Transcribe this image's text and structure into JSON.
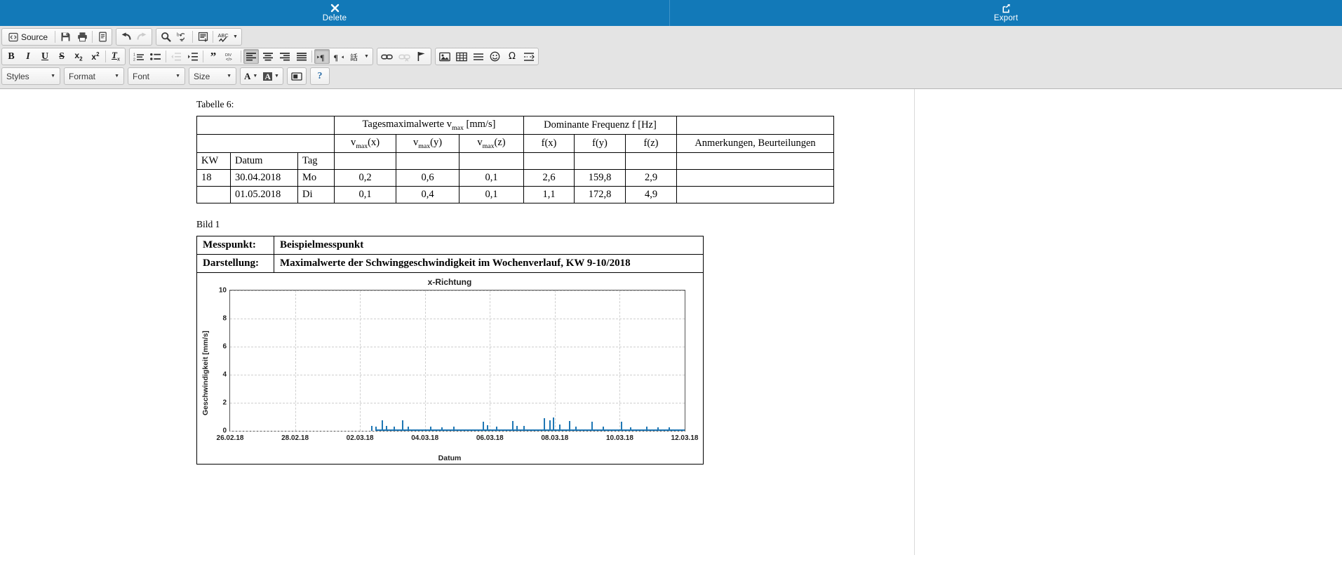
{
  "action_bar": {
    "background": "#1279b8",
    "buttons": [
      {
        "id": "delete",
        "label": "Delete",
        "icon": "close-x-icon"
      },
      {
        "id": "export",
        "label": "Export",
        "icon": "export-share-icon"
      }
    ]
  },
  "toolbar": {
    "source_label": "Source",
    "row1": [
      {
        "name": "source-button",
        "label": "Source",
        "icon": "source-code-icon"
      },
      {
        "name": "save-button",
        "icon": "floppy-save-icon"
      },
      {
        "name": "print-button",
        "icon": "printer-icon"
      },
      {
        "name": "new-page-button",
        "icon": "document-icon"
      },
      {
        "name": "undo-button",
        "icon": "undo-arrow-icon"
      },
      {
        "name": "redo-button",
        "icon": "redo-arrow-icon"
      },
      {
        "name": "find-button",
        "icon": "magnifier-icon"
      },
      {
        "name": "replace-button",
        "icon": "replace-ba-icon"
      },
      {
        "name": "select-all-button",
        "icon": "select-all-icon"
      },
      {
        "name": "spellcheck-button",
        "icon": "abc-check-icon"
      }
    ],
    "row2": [
      {
        "name": "bold-button",
        "icon": "bold-icon",
        "glyph": "B"
      },
      {
        "name": "italic-button",
        "icon": "italic-icon",
        "glyph": "I"
      },
      {
        "name": "underline-button",
        "icon": "underline-icon",
        "glyph": "U"
      },
      {
        "name": "strikethrough-button",
        "icon": "strikethrough-icon",
        "glyph": "S"
      },
      {
        "name": "subscript-button",
        "icon": "subscript-icon",
        "glyph": "x₂"
      },
      {
        "name": "superscript-button",
        "icon": "superscript-icon",
        "glyph": "x²"
      },
      {
        "name": "remove-format-button",
        "icon": "remove-format-icon",
        "glyph": "Tx"
      },
      {
        "name": "numbered-list-button",
        "icon": "numbered-list-icon"
      },
      {
        "name": "bulleted-list-button",
        "icon": "bulleted-list-icon"
      },
      {
        "name": "decrease-indent-button",
        "icon": "decrease-indent-icon"
      },
      {
        "name": "increase-indent-button",
        "icon": "increase-indent-icon"
      },
      {
        "name": "blockquote-button",
        "icon": "quote-icon"
      },
      {
        "name": "create-div-button",
        "icon": "div-container-icon"
      },
      {
        "name": "align-left-button",
        "icon": "align-left-icon",
        "active": true
      },
      {
        "name": "align-center-button",
        "icon": "align-center-icon"
      },
      {
        "name": "align-right-button",
        "icon": "align-right-icon"
      },
      {
        "name": "align-justify-button",
        "icon": "align-justify-icon"
      },
      {
        "name": "text-direction-ltr-button",
        "icon": "direction-ltr-icon",
        "active": true
      },
      {
        "name": "text-direction-rtl-button",
        "icon": "direction-rtl-icon"
      },
      {
        "name": "language-button",
        "icon": "language-icon"
      },
      {
        "name": "link-button",
        "icon": "link-icon"
      },
      {
        "name": "unlink-button",
        "icon": "unlink-icon",
        "disabled": true
      },
      {
        "name": "anchor-button",
        "icon": "flag-anchor-icon"
      },
      {
        "name": "image-button",
        "icon": "image-icon"
      },
      {
        "name": "table-button",
        "icon": "table-icon"
      },
      {
        "name": "horizontal-rule-button",
        "icon": "horizontal-rule-icon"
      },
      {
        "name": "smiley-button",
        "icon": "smiley-icon"
      },
      {
        "name": "special-char-button",
        "icon": "omega-icon",
        "glyph": "Ω"
      },
      {
        "name": "page-break-button",
        "icon": "page-break-icon"
      }
    ],
    "row3": {
      "styles": "Styles",
      "format": "Format",
      "font": "Font",
      "size": "Size",
      "text_color": "A",
      "bg_color": "A",
      "maximize": "maximize-icon",
      "about": "?"
    }
  },
  "document": {
    "table_caption": "Tabelle 6:",
    "table": {
      "group_headers": [
        {
          "label": "",
          "colspan": 3
        },
        {
          "label": "Tagesmaximalwerte v_max [mm/s]",
          "text": "Tagesmaximalwerte v",
          "sub": "max",
          "tail": " [mm/s]",
          "colspan": 3
        },
        {
          "label": "Dominante Frequenz f [Hz]",
          "colspan": 3
        },
        {
          "label": "",
          "colspan": 1
        }
      ],
      "sub_headers": [
        "",
        "",
        "",
        "vmax(x)",
        "vmax(y)",
        "vmax(z)",
        "f(x)",
        "f(y)",
        "f(z)",
        "Anmerkungen, Beurteilungen"
      ],
      "sub_headers_parts": [
        {
          "base": "v",
          "sub": "max",
          "tail": "(x)"
        },
        {
          "base": "v",
          "sub": "max",
          "tail": "(y)"
        },
        {
          "base": "v",
          "sub": "max",
          "tail": "(z)"
        }
      ],
      "freq_headers": [
        "f(x)",
        "f(y)",
        "f(z)"
      ],
      "remarks_header": "Anmerkungen, Beurteilungen",
      "key_headers": [
        "KW",
        "Datum",
        "Tag"
      ],
      "rows": [
        {
          "kw": "18",
          "datum": "30.04.2018",
          "tag": "Mo",
          "vmax_x": "0,2",
          "vmax_y": "0,6",
          "vmax_z": "0,1",
          "fx": "2,6",
          "fy": "159,8",
          "fz": "2,9",
          "remark": ""
        },
        {
          "kw": "",
          "datum": "01.05.2018",
          "tag": "Di",
          "vmax_x": "0,1",
          "vmax_y": "0,4",
          "vmax_z": "0,1",
          "fx": "1,1",
          "fy": "172,8",
          "fz": "4,9",
          "remark": ""
        }
      ]
    },
    "bild_caption": "Bild 1",
    "bild": {
      "messpunkt_label": "Messpunkt:",
      "messpunkt_value": "Beispielmesspunkt",
      "darstellung_label": "Darstellung:",
      "darstellung_value": "Maximalwerte der Schwinggeschwindigkeit im Wochenverlauf, KW 9-10/2018"
    }
  },
  "chart_data": {
    "type": "bar",
    "title": "x-Richtung",
    "xlabel": "Datum",
    "ylabel": "Geschwindigkeit [mm/s]",
    "ylim": [
      0,
      10
    ],
    "yticks": [
      0,
      2,
      4,
      6,
      8,
      10
    ],
    "xticks": [
      "26.02.18",
      "28.02.18",
      "02.03.18",
      "04.03.18",
      "06.03.18",
      "08.03.18",
      "10.03.18",
      "12.03.18"
    ],
    "series_color": "#1f77b4",
    "grid": true,
    "legend": "none",
    "x_start": "26.02.18",
    "x_end": "12.03.18",
    "note": "Sparse spikes over a near-zero baseline; maxima around 0.9 mm/s",
    "spikes": [
      {
        "x": 31.0,
        "y": 0.35
      },
      {
        "x": 32.0,
        "y": 0.3
      },
      {
        "x": 33.4,
        "y": 0.72
      },
      {
        "x": 34.2,
        "y": 0.33
      },
      {
        "x": 36.0,
        "y": 0.3
      },
      {
        "x": 37.8,
        "y": 0.72
      },
      {
        "x": 39.0,
        "y": 0.3
      },
      {
        "x": 44.0,
        "y": 0.28
      },
      {
        "x": 46.5,
        "y": 0.25
      },
      {
        "x": 49.0,
        "y": 0.3
      },
      {
        "x": 55.5,
        "y": 0.65
      },
      {
        "x": 56.5,
        "y": 0.4
      },
      {
        "x": 58.5,
        "y": 0.28
      },
      {
        "x": 62.0,
        "y": 0.7
      },
      {
        "x": 63.0,
        "y": 0.35
      },
      {
        "x": 64.5,
        "y": 0.32
      },
      {
        "x": 69.0,
        "y": 0.88
      },
      {
        "x": 70.2,
        "y": 0.75
      },
      {
        "x": 71.0,
        "y": 0.92
      },
      {
        "x": 72.4,
        "y": 0.42
      },
      {
        "x": 74.5,
        "y": 0.7
      },
      {
        "x": 76.0,
        "y": 0.3
      },
      {
        "x": 79.5,
        "y": 0.62
      },
      {
        "x": 82.0,
        "y": 0.28
      },
      {
        "x": 86.0,
        "y": 0.66
      },
      {
        "x": 88.0,
        "y": 0.26
      },
      {
        "x": 91.5,
        "y": 0.28
      },
      {
        "x": 94.0,
        "y": 0.24
      },
      {
        "x": 96.5,
        "y": 0.26
      }
    ]
  }
}
